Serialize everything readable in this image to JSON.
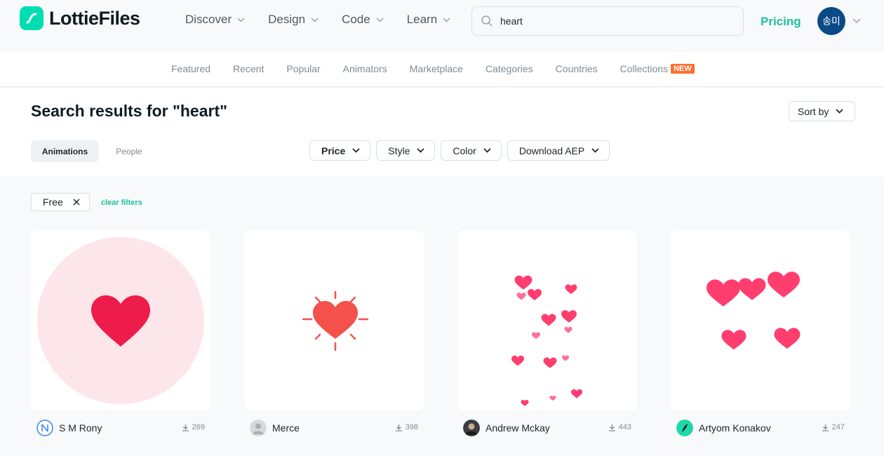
{
  "brand": {
    "name": "LottieFiles",
    "logo_color": "#00ddb3"
  },
  "nav": [
    {
      "label": "Discover"
    },
    {
      "label": "Design"
    },
    {
      "label": "Code"
    },
    {
      "label": "Learn"
    }
  ],
  "search": {
    "value": "heart",
    "icon": "search-icon"
  },
  "pricing_label": "Pricing",
  "user": {
    "initials": "송미",
    "avatar_color": "#0a4b87"
  },
  "subnav": [
    {
      "label": "Featured"
    },
    {
      "label": "Recent"
    },
    {
      "label": "Popular"
    },
    {
      "label": "Animators"
    },
    {
      "label": "Marketplace"
    },
    {
      "label": "Categories"
    },
    {
      "label": "Countries"
    },
    {
      "label": "Collections",
      "badge": "NEW"
    }
  ],
  "results": {
    "title": "Search results for \"heart\"",
    "sort_label": "Sort by",
    "tabs": [
      {
        "label": "Animations",
        "active": true
      },
      {
        "label": "People",
        "active": false
      }
    ],
    "filters": [
      {
        "label": "Price"
      },
      {
        "label": "Style"
      },
      {
        "label": "Color"
      },
      {
        "label": "Download AEP"
      }
    ],
    "active_filter": "Free",
    "clear_label": "clear filters"
  },
  "cards": [
    {
      "author": "S M Rony",
      "downloads": "269"
    },
    {
      "author": "Merce",
      "downloads": "398"
    },
    {
      "author": "Andrew Mckay",
      "downloads": "443"
    },
    {
      "author": "Artyom Konakov",
      "downloads": "247"
    }
  ],
  "colors": {
    "accent": "#19c29f",
    "badge": "#ff6e2f",
    "heart": "#ff3d6e"
  }
}
